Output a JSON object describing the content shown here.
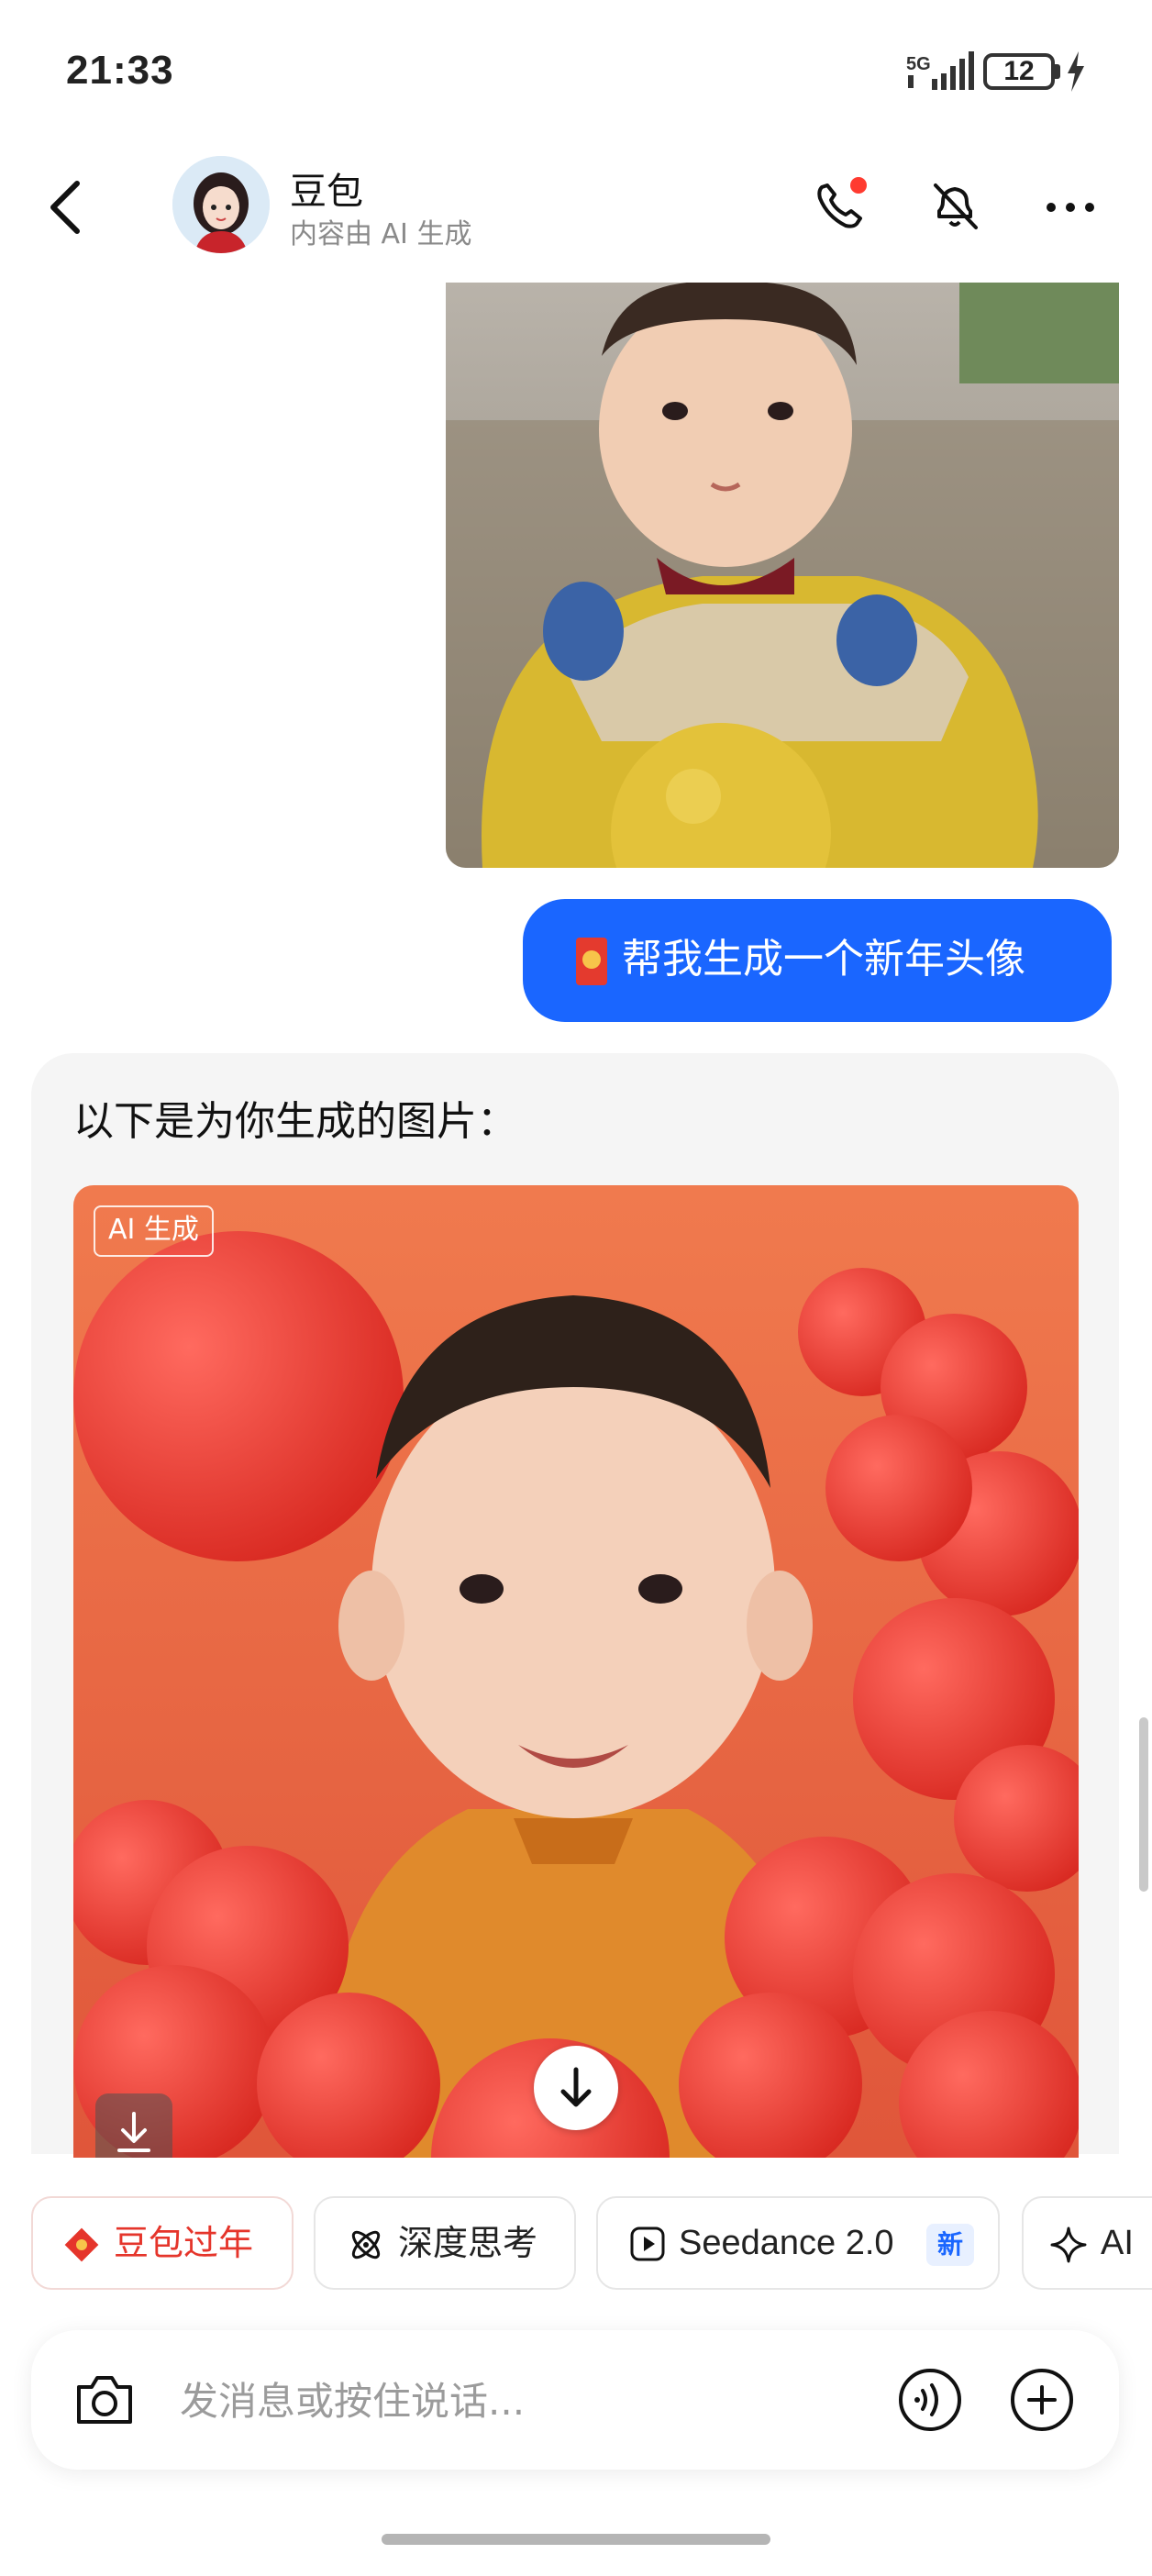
{
  "status_bar": {
    "time": "21:33",
    "network": "5G",
    "battery": "12"
  },
  "header": {
    "bot_name": "豆包",
    "subtitle": "内容由 AI 生成",
    "icons": [
      "back-icon",
      "phone-icon",
      "mute-icon",
      "more-icon"
    ],
    "call_badge_color": "#ff3b30"
  },
  "messages": {
    "user_text": "帮我生成一个新年头像",
    "ai_text": "以下是为你生成的图片：",
    "ai_image_tag": "AI 生成"
  },
  "chips": [
    {
      "label": "豆包过年",
      "icon": "lantern-icon",
      "color": "#e5352b"
    },
    {
      "label": "深度思考",
      "icon": "atom-icon"
    },
    {
      "label": "Seedance 2.0",
      "icon": "play-icon",
      "badge": "新"
    },
    {
      "label": "AI",
      "icon": "sparkle-icon"
    }
  ],
  "input": {
    "placeholder": "发消息或按住说话..."
  },
  "colors": {
    "accent": "#1a66ff",
    "bubble_bg": "#f5f5f5"
  }
}
